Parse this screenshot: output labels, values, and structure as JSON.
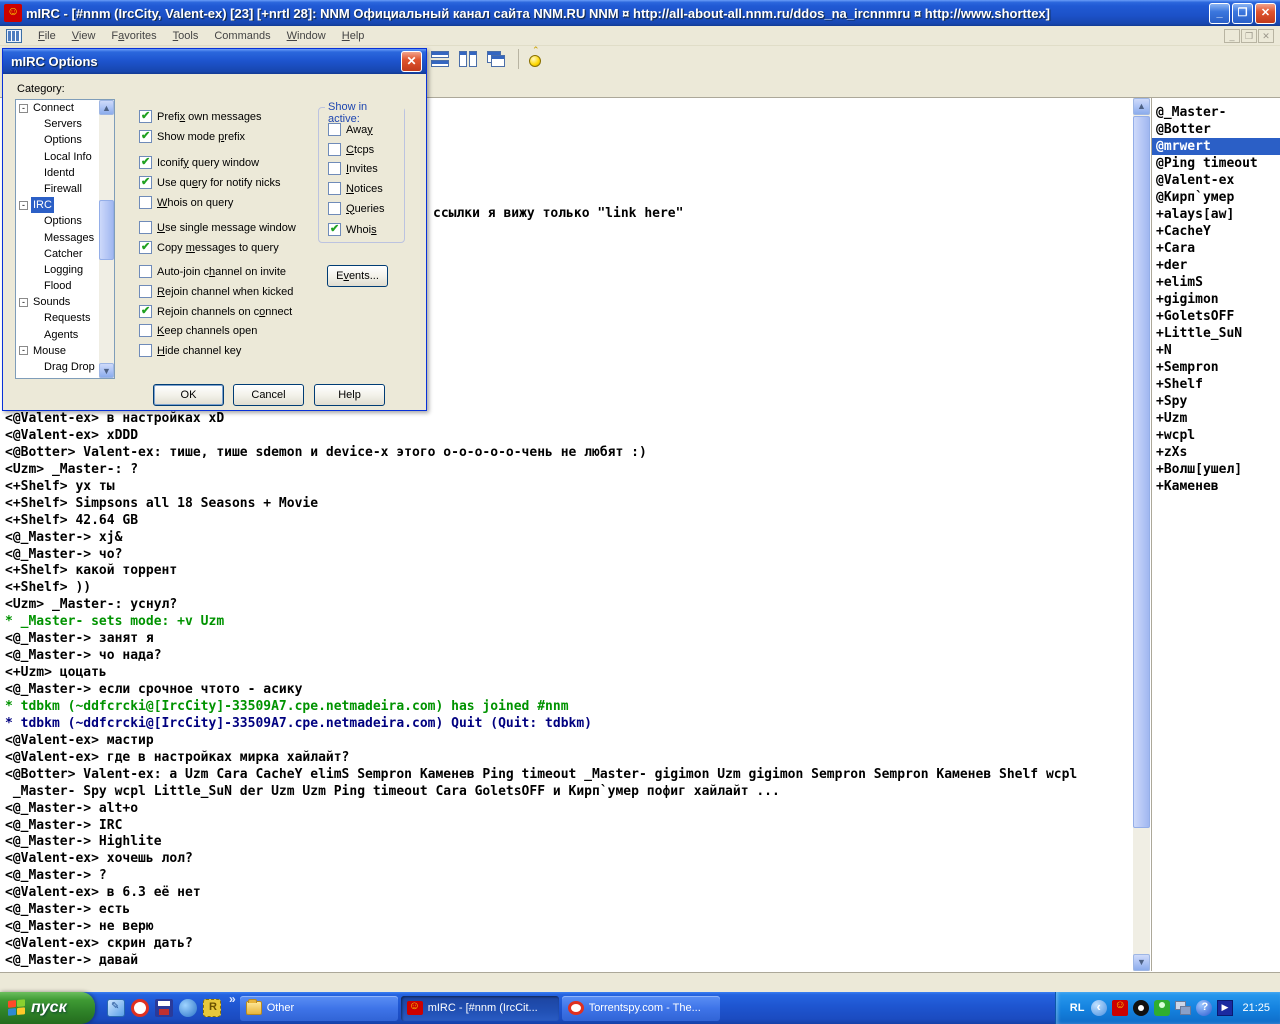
{
  "window": {
    "title": "mIRC - [#nnm (IrcCity, Valent-ex) [23] [+nrtl 28]: NNM Официальный канал сайта NNM.RU NNM ¤ http://all-about-all.nnm.ru/ddos_na_ircnnmru ¤ http://www.shorttex]",
    "buttons": {
      "minimize": "_",
      "restore": "❐",
      "close": "✕"
    },
    "menu": [
      {
        "label": "File",
        "ul": 0
      },
      {
        "label": "View",
        "ul": 0
      },
      {
        "label": "Favorites",
        "ul": 1
      },
      {
        "label": "Tools",
        "ul": 0
      },
      {
        "label": "Commands",
        "ul": -1
      },
      {
        "label": "Window",
        "ul": 0
      },
      {
        "label": "Help",
        "ul": 0
      }
    ]
  },
  "toolbar": {
    "icons": [
      "tile-vertical-icon",
      "tile-horizontal-icon",
      "cascade-icon",
      "switch-icon"
    ]
  },
  "dialog": {
    "title": "mIRC Options",
    "close": "✕",
    "category_label": "Category:",
    "tree": [
      {
        "label": "Connect",
        "depth": 0,
        "expander": "-",
        "selected": false
      },
      {
        "label": "Servers",
        "depth": 1,
        "expander": "",
        "selected": false
      },
      {
        "label": "Options",
        "depth": 1,
        "expander": "",
        "selected": false
      },
      {
        "label": "Local Info",
        "depth": 1,
        "expander": "",
        "selected": false
      },
      {
        "label": "Identd",
        "depth": 1,
        "expander": "",
        "selected": false
      },
      {
        "label": "Firewall",
        "depth": 1,
        "expander": "",
        "selected": false
      },
      {
        "label": "IRC",
        "depth": 0,
        "expander": "-",
        "selected": true
      },
      {
        "label": "Options",
        "depth": 1,
        "expander": "",
        "selected": false
      },
      {
        "label": "Messages",
        "depth": 1,
        "expander": "",
        "selected": false
      },
      {
        "label": "Catcher",
        "depth": 1,
        "expander": "",
        "selected": false
      },
      {
        "label": "Logging",
        "depth": 1,
        "expander": "",
        "selected": false
      },
      {
        "label": "Flood",
        "depth": 1,
        "expander": "",
        "selected": false
      },
      {
        "label": "Sounds",
        "depth": 0,
        "expander": "-",
        "selected": false
      },
      {
        "label": "Requests",
        "depth": 1,
        "expander": "",
        "selected": false
      },
      {
        "label": "Agents",
        "depth": 1,
        "expander": "",
        "selected": false
      },
      {
        "label": "Mouse",
        "depth": 0,
        "expander": "-",
        "selected": false
      },
      {
        "label": "Drag Drop",
        "depth": 1,
        "expander": "",
        "selected": false
      }
    ],
    "checkboxes": [
      {
        "label": "Prefix own messages",
        "ul": 5,
        "checked": true
      },
      {
        "label": "Show mode prefix",
        "ul": 10,
        "checked": true
      },
      {
        "label": "Iconify query window",
        "ul": 6,
        "checked": true
      },
      {
        "label": "Use query for notify nicks",
        "ul": 6,
        "checked": true
      },
      {
        "label": "Whois on query",
        "ul": 0,
        "checked": false
      },
      {
        "label": "Use single message window",
        "ul": 0,
        "checked": false
      },
      {
        "label": "Copy messages to query",
        "ul": 5,
        "checked": true
      },
      {
        "label": "Auto-join channel on invite",
        "ul": 11,
        "checked": false
      },
      {
        "label": "Rejoin channel when kicked",
        "ul": 0,
        "checked": false
      },
      {
        "label": "Rejoin channels on connect",
        "ul": 20,
        "checked": true
      },
      {
        "label": "Keep channels open",
        "ul": 0,
        "checked": false
      },
      {
        "label": "Hide channel key",
        "ul": 0,
        "checked": false
      }
    ],
    "group": {
      "title": "Show in active:",
      "items": [
        {
          "label": "Away",
          "ul": 3,
          "checked": false
        },
        {
          "label": "Ctcps",
          "ul": 0,
          "checked": false
        },
        {
          "label": "Invites",
          "ul": 0,
          "checked": false
        },
        {
          "label": "Notices",
          "ul": 0,
          "checked": false
        },
        {
          "label": "Queries",
          "ul": 0,
          "checked": false
        },
        {
          "label": "Whois",
          "ul": 4,
          "checked": true
        }
      ]
    },
    "events_button": {
      "label": "Events...",
      "ul": 1
    },
    "ok_label": "OK",
    "cancel_label": "Cancel",
    "help_label": "Help"
  },
  "chat": {
    "partial_top_line": "ссылки я вижу только \"link here\"",
    "lines": [
      {
        "text": "<@Valent-ex> в настройках xD",
        "color": "normal"
      },
      {
        "text": "<@Valent-ex> xDDD",
        "color": "normal"
      },
      {
        "text": "<@Botter> Valent-ex: тише, тише sdemon и device-x этого о-о-о-о-о-чень не любят :)",
        "color": "normal"
      },
      {
        "text": "<Uzm> _Master-: ?",
        "color": "normal"
      },
      {
        "text": "<+Shelf> ух ты",
        "color": "normal"
      },
      {
        "text": "<+Shelf> Simpsons all 18 Seasons + Movie",
        "color": "normal"
      },
      {
        "text": "<+Shelf> 42.64 GB",
        "color": "normal"
      },
      {
        "text": "<@_Master-> xj&",
        "color": "normal"
      },
      {
        "text": "<@_Master-> чо?",
        "color": "normal"
      },
      {
        "text": "<+Shelf> какой торрент",
        "color": "normal"
      },
      {
        "text": "<+Shelf> ))",
        "color": "normal"
      },
      {
        "text": "<Uzm> _Master-: уснул?",
        "color": "normal"
      },
      {
        "text": "* _Master- sets mode: +v Uzm",
        "color": "green"
      },
      {
        "text": "<@_Master-> занят я",
        "color": "normal"
      },
      {
        "text": "<@_Master-> чо нада?",
        "color": "normal"
      },
      {
        "text": "<+Uzm> цоцать",
        "color": "normal"
      },
      {
        "text": "<@_Master-> если срочное чтото - асику",
        "color": "normal"
      },
      {
        "text": "* tdbkm (~ddfcrcki@[IrcCity]-33509A7.cpe.netmadeira.com) has joined #nnm",
        "color": "green"
      },
      {
        "text": "* tdbkm (~ddfcrcki@[IrcCity]-33509A7.cpe.netmadeira.com) Quit (Quit: tdbkm)",
        "color": "navy"
      },
      {
        "text": "<@Valent-ex> мастир",
        "color": "normal"
      },
      {
        "text": "<@Valent-ex> где в настройках мирка хайлайт?",
        "color": "normal"
      },
      {
        "text": "<@Botter> Valent-ex: a Uzm Cara CacheY elimS Sempron Каменев Ping timeout _Master- gigimon Uzm gigimon Sempron Sempron Каменев Shelf wcpl",
        "color": "normal"
      },
      {
        "text": " _Master- Spy wcpl Little_SuN der Uzm Uzm Ping timeout Cara GoletsOFF и Кирп`умер пофиг хайлайт ...",
        "color": "normal"
      },
      {
        "text": "<@_Master-> alt+o",
        "color": "normal"
      },
      {
        "text": "<@_Master-> IRC",
        "color": "normal"
      },
      {
        "text": "<@_Master-> Highlite",
        "color": "normal"
      },
      {
        "text": "<@Valent-ex> хочешь лол?",
        "color": "normal"
      },
      {
        "text": "<@_Master-> ?",
        "color": "normal"
      },
      {
        "text": "<@Valent-ex> в 6.3 её нет",
        "color": "normal"
      },
      {
        "text": "<@_Master-> есть",
        "color": "normal"
      },
      {
        "text": "<@_Master-> не верю",
        "color": "normal"
      },
      {
        "text": "<@Valent-ex> скрин дать?",
        "color": "normal"
      },
      {
        "text": "<@_Master-> давай",
        "color": "normal"
      }
    ]
  },
  "nicklist": {
    "selected_index": 2,
    "items": [
      "@_Master-",
      "@Botter",
      "@mrwert",
      "@Ping timeout",
      "@Valent-ex",
      "@Кирп`умер",
      "+alays[aw]",
      "+CacheY",
      "+Cara",
      "+der",
      "+elimS",
      "+gigimon",
      "+GoletsOFF",
      "+Little_SuN",
      "+N",
      "+Sempron",
      "+Shelf",
      "+Spy",
      "+Uzm",
      "+wcpl",
      "+zXs",
      "+Волш[ушел]",
      "+Каменев"
    ]
  },
  "taskbar": {
    "start_label": "пуск",
    "quick_launch": [
      "show-desktop-icon",
      "opera-icon",
      "save-icon",
      "browser-icon",
      "rstudio-icon"
    ],
    "overflow_chevron": "»",
    "buttons": [
      {
        "label": "Other",
        "icon": "folder-icon",
        "active": false
      },
      {
        "label": "mIRC - [#nnm (IrcCit...",
        "icon": "mirc-icon",
        "active": true
      },
      {
        "label": "Torrentspy.com - The...",
        "icon": "opera-icon",
        "active": false
      }
    ],
    "tray": {
      "language": "RL",
      "icons": [
        "chevron-left-icon",
        "mirc-tray-icon",
        "steam-icon",
        "qip-icon",
        "network-icon",
        "help-icon",
        "player-icon"
      ],
      "clock": "21:25"
    }
  }
}
